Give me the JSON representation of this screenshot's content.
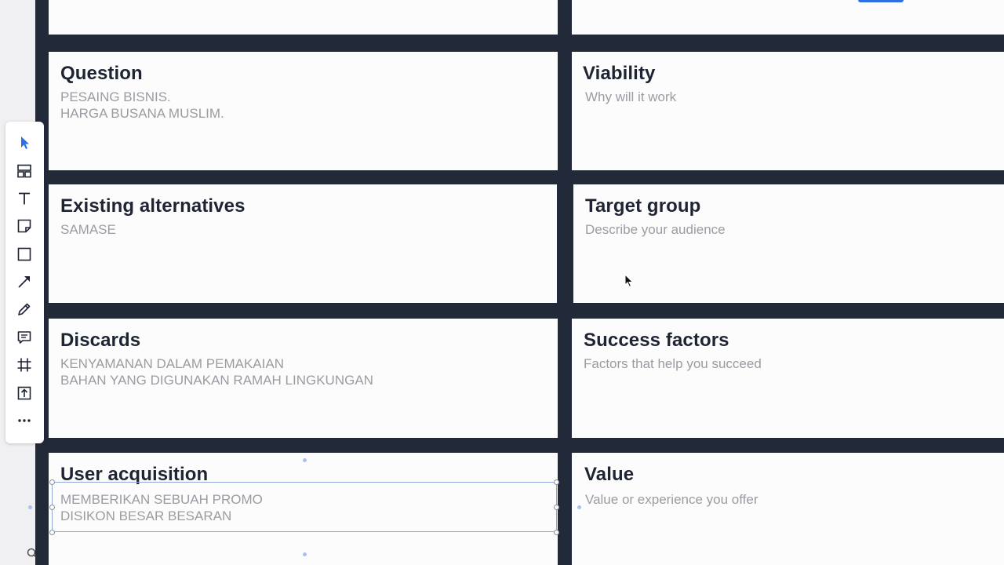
{
  "cards": [
    {
      "title": "",
      "lines": []
    },
    {
      "title": "",
      "lines": []
    },
    {
      "title": "Question",
      "lines": [
        "PESAING BISNIS.",
        "HARGA BUSANA MUSLIM."
      ]
    },
    {
      "title": "Viability",
      "lines": [
        "Why will it work"
      ]
    },
    {
      "title": "Existing alternatives",
      "lines": [
        "SAMASE"
      ]
    },
    {
      "title": "Target group",
      "lines": [
        "Describe your audience"
      ]
    },
    {
      "title": "Discards",
      "lines": [
        "KENYAMANAN DALAM PEMAKAIAN",
        "BAHAN YANG DIGUNAKAN RAMAH LINGKUNGAN"
      ]
    },
    {
      "title": "Success factors",
      "lines": [
        "Factors that help you succeed"
      ]
    },
    {
      "title": "User acquisition",
      "lines": [
        "MEMBERIKAN SEBUAH PROMO",
        "DISIKON BESAR BESARAN"
      ]
    },
    {
      "title": "Value",
      "lines": [
        "Value or experience you offer"
      ]
    }
  ],
  "toolbar": {
    "tools": [
      {
        "name": "select-tool",
        "icon": "cursor-arrow-icon"
      },
      {
        "name": "templates-tool",
        "icon": "layout-icon"
      },
      {
        "name": "text-tool",
        "icon": "text-icon"
      },
      {
        "name": "sticky-note-tool",
        "icon": "sticky-note-icon"
      },
      {
        "name": "shape-tool",
        "icon": "square-icon"
      },
      {
        "name": "connector-tool",
        "icon": "arrow-line-icon"
      },
      {
        "name": "pen-tool",
        "icon": "pen-icon"
      },
      {
        "name": "comment-tool",
        "icon": "comment-icon"
      },
      {
        "name": "frame-tool",
        "icon": "frame-icon"
      },
      {
        "name": "upload-tool",
        "icon": "upload-icon"
      },
      {
        "name": "more-tools",
        "icon": "more-dots-icon"
      }
    ]
  },
  "colors": {
    "board_background": "#222a3a",
    "card_background": "#fcfcfd",
    "title": "#1e2433",
    "body_text": "#9a9ca2",
    "accent": "#2f6fe6"
  }
}
